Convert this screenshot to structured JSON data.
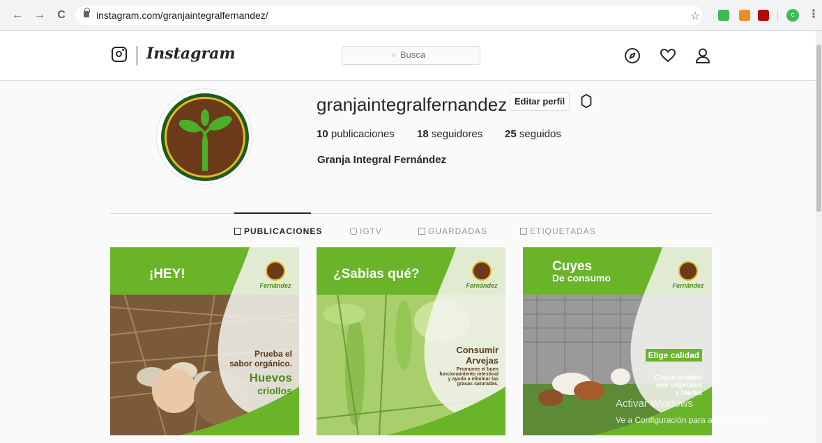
{
  "browser": {
    "url": "instagram.com/granjaintegralfernandez/",
    "back": "←",
    "forward": "→",
    "reload": "C",
    "star": "☆",
    "profile_initial": "c",
    "menu": "⋮"
  },
  "header": {
    "wordmark": "Instagram",
    "search_placeholder": "Busca",
    "search_icon": "Q"
  },
  "profile": {
    "username": "granjaintegralfernandez",
    "edit_button": "Editar perfil",
    "posts_count": "10",
    "posts_label": " publicaciones",
    "followers_count": "18",
    "followers_label": " seguidores",
    "following_count": "25",
    "following_label": " seguidos",
    "full_name": "Granja Integral Fernández"
  },
  "tabs": [
    {
      "label": "PUBLICACIONES",
      "active": true
    },
    {
      "label": "IGTV",
      "active": false
    },
    {
      "label": "GUARDADAS",
      "active": false
    },
    {
      "label": "ETIQUETADAS",
      "active": false
    }
  ],
  "posts": [
    {
      "title": "¡HEY!",
      "logo_word": "Fernández",
      "line1": "Prueba el",
      "line2": "sabor orgánico.",
      "big1": "Huevos",
      "big2": "criollos"
    },
    {
      "title": "¿Sabias qué?",
      "logo_word": "Fernández",
      "big1": "Consumir",
      "big2": "Arvejas",
      "small1": "Promueve el buen",
      "small2": "funcionamiento intestinal",
      "small3": "y ayuda a eliminar las",
      "small4": "grasas saturadas."
    },
    {
      "title_line1": "Cuyes",
      "title_line2": "De consumo",
      "logo_word": "Fernández",
      "big1": "Elige calidad",
      "small1": "Cuyes  criados",
      "small2": "con vegetales",
      "small3": "y hierba"
    }
  ],
  "watermark": {
    "line1": "Activar Windows",
    "line2": "Ve a Configuración para activar Windows."
  },
  "colors": {
    "brand_green": "#6ab42a",
    "logo_brown": "#6b3a1a",
    "logo_ring": "#e4b922"
  }
}
